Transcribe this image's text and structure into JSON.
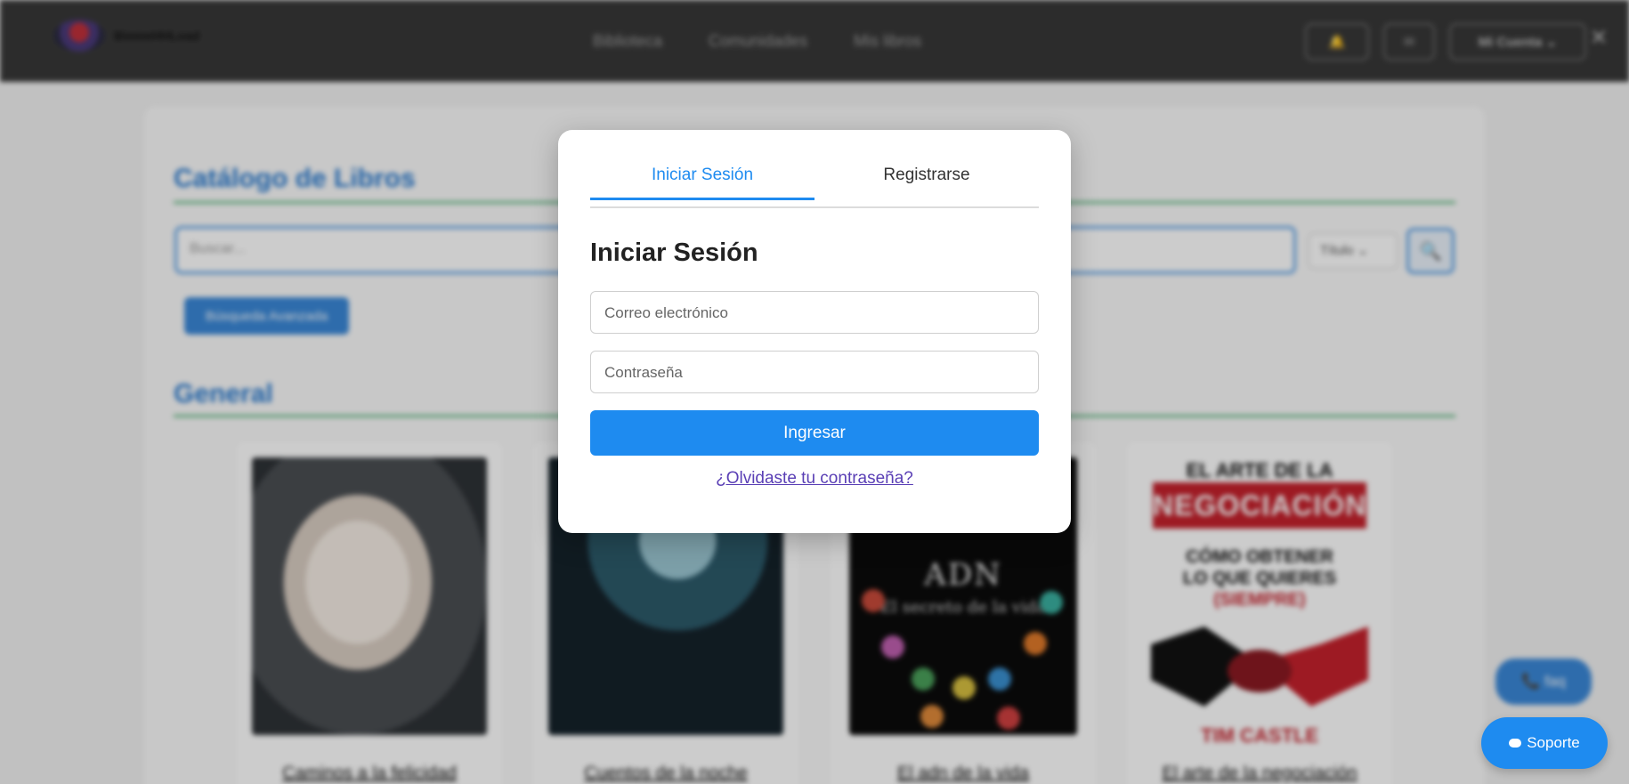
{
  "header": {
    "brand": "BiomeHHLoad",
    "nav": [
      "Biblioteca",
      "Comunidades",
      "Mis libros"
    ],
    "account_label": "Mi Cuenta",
    "close_glyph": "✕"
  },
  "catalog": {
    "title": "Catálogo de Libros",
    "search_placeholder": "Buscar...",
    "search_filter": "Título",
    "search_icon": "🔍",
    "advanced_label": "Búsqueda Avanzada"
  },
  "general": {
    "title": "General",
    "books": [
      {
        "title": "Caminos a la felicidad"
      },
      {
        "title": "Cuentos de la noche"
      },
      {
        "title": "El adn de la vida"
      },
      {
        "title": "El arte de la negociación"
      }
    ]
  },
  "adn_cover": {
    "title": "ADN",
    "subtitle": "El secreto de la vida"
  },
  "neg_cover": {
    "head": "EL ARTE DE LA",
    "band": "NEGOCIACIÓN",
    "line1": "CÓMO OBTENER",
    "line2": "LO QUE QUIERES",
    "line3": "(SIEMPRE)",
    "author": "TIM CASTLE"
  },
  "faq_label": "📞 faq",
  "modal": {
    "tab_login": "Iniciar Sesión",
    "tab_register": "Registrarse",
    "heading": "Iniciar Sesión",
    "email_placeholder": "Correo electrónico",
    "password_placeholder": "Contraseña",
    "submit_label": "Ingresar",
    "forgot_label": "¿Olvidaste tu contraseña?"
  },
  "support_label": "Soporte",
  "colors": {
    "accent": "#1e8bf0",
    "navbar": "#383838",
    "link": "#5a3fb5",
    "section_rule": "#6bbf8a"
  }
}
